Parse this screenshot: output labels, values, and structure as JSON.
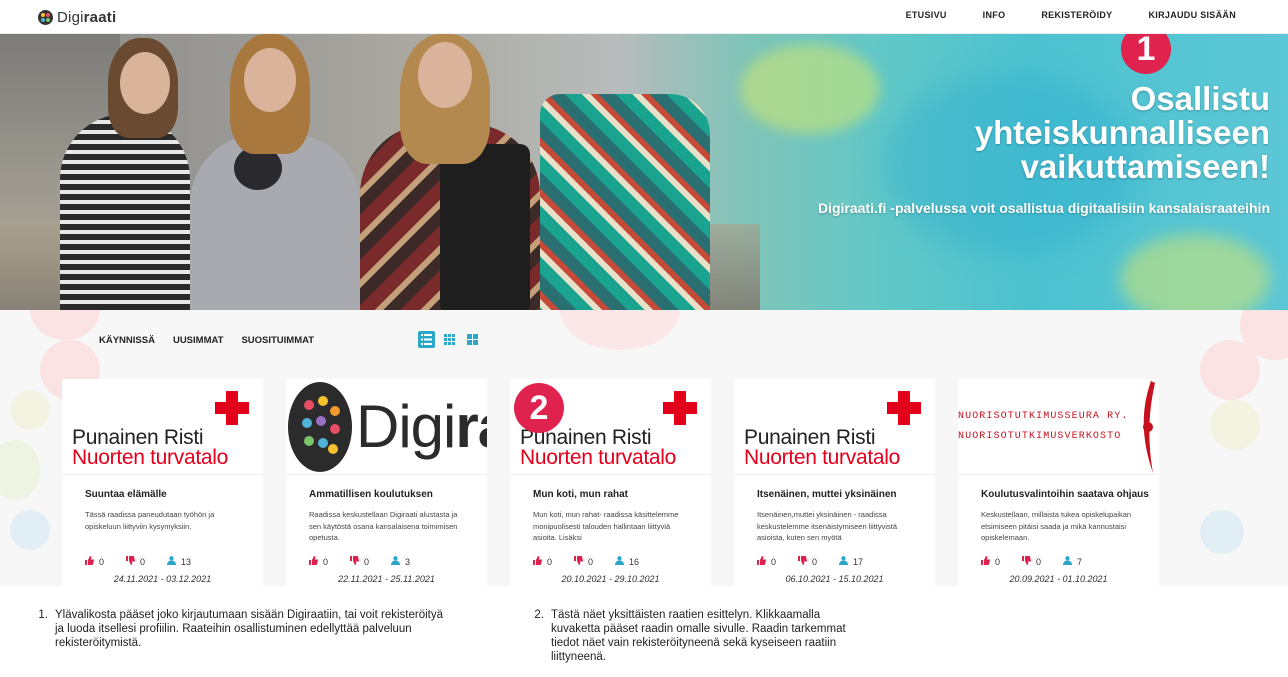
{
  "app": {
    "logo_prefix": "Digi",
    "logo_suffix": "raati"
  },
  "nav": {
    "items": [
      "ETUSIVU",
      "INFO",
      "REKISTERÖIDY",
      "KIRJAUDU SISÄÄN"
    ]
  },
  "hero": {
    "title": "Osallistu yhteiskunnalliseen vaikuttamiseen!",
    "subtitle": "Digiraati.fi -palvelussa voit osallistua digitaalisiin kansalaisraateihin",
    "marker": "1"
  },
  "filters": [
    "KÄYNNISSÄ",
    "UUSIMMAT",
    "SUOSITUIMMAT"
  ],
  "view_modes": [
    "list-view-icon",
    "grid-small-icon",
    "grid-large-icon"
  ],
  "marker2": "2",
  "cards": [
    {
      "logo": "punainen-risti",
      "logo_line1": "Punainen Risti",
      "logo_line2": "Nuorten turvatalo",
      "title": "Suuntaa elämälle",
      "desc": "Tässä raadissa paneudutaan työhön ja opiskeluun liittyviin kysymyksiin.",
      "likes": "0",
      "dislikes": "0",
      "participants": "13",
      "dates": "24.11.2021 - 03.12.2021"
    },
    {
      "logo": "digiraati",
      "logo_line1": "Digi",
      "logo_line2": "raati",
      "title": "Ammatillisen koulutuksen",
      "desc": "Raadissa keskustellaan Digiraati alustasta ja sen käytöstä osana kansalaisena toimimisen opetusta.",
      "likes": "0",
      "dislikes": "0",
      "participants": "3",
      "dates": "22.11.2021 - 25.11.2021"
    },
    {
      "logo": "punainen-risti",
      "logo_line1": "Punainen Risti",
      "logo_line2": "Nuorten turvatalo",
      "title": "Mun koti, mun rahat",
      "desc": "Mun koti, mun rahat- raadissa käsittelemme monipuolisesti talouden hallintaan liittyviä asioita. Lisäksi",
      "likes": "0",
      "dislikes": "0",
      "participants": "16",
      "dates": "20.10.2021 - 29.10.2021"
    },
    {
      "logo": "punainen-risti",
      "logo_line1": "Punainen Risti",
      "logo_line2": "Nuorten turvatalo",
      "title": "Itsenäinen, muttei yksinäinen",
      "desc": "Itsenäinen,muttei yksinäinen - raadissa keskustelemme itsenäistymiseen liittyvistä asioista, kuten sen myötä",
      "likes": "0",
      "dislikes": "0",
      "participants": "17",
      "dates": "06.10.2021 - 15.10.2021"
    },
    {
      "logo": "nuorisotutkimus",
      "logo_line1": "NUORISOTUTKIMUSSEURA RY.",
      "logo_line2": "NUORISOTUTKIMUSVERKOSTO",
      "title": "Koulutusvalintoihin saatava ohjaus",
      "desc": "Keskustellaan, millaista tukea opiskelupaikan etsimiseen pitäisi saada ja mikä kannustaisi opiskelemaan.",
      "likes": "0",
      "dislikes": "0",
      "participants": "7",
      "dates": "20.09.2021 - 01.10.2021"
    }
  ],
  "notes": [
    {
      "num": "1.",
      "text": "Ylävalikosta pääset joko kirjautumaan sisään Digiraatiin, tai voit rekisteröityä ja luoda itsellesi profiilin. Raateihin osallistuminen edellyttää palveluun rekisteröitymistä."
    },
    {
      "num": "2.",
      "text": "Tästä näet yksittäisten raatien esittelyn. Klikkaamalla kuvaketta pääset raadin omalle sivulle. Raadin tarkemmat tiedot näet vain rekisteröityneenä sekä kyseiseen raatiin liittyneenä."
    }
  ],
  "colors": {
    "accent": "#2aa7c9",
    "marker": "#e0234e",
    "red_cross": "#e3001b"
  }
}
